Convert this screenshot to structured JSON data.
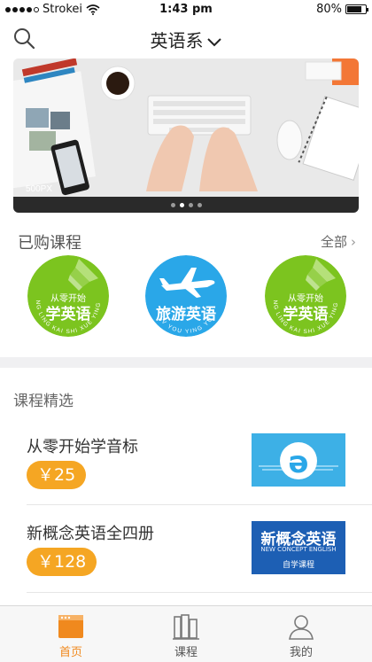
{
  "status_bar": {
    "carrier": "Strokei",
    "time": "1:43 pm",
    "battery": "80%",
    "battery_level": 0.8,
    "signal_bars_filled": 4
  },
  "nav": {
    "title": "英语系"
  },
  "banner": {
    "watermark": "500PX",
    "slide_count": 4,
    "active_slide": 1
  },
  "purchased": {
    "title": "已购课程",
    "view_all": "全部",
    "courses": [
      {
        "sub": "从零开始",
        "main": "学英语",
        "curve": "CONG LING KAI SHI XUE YING YU",
        "color": "#7cc41f"
      },
      {
        "sub": "",
        "main": "旅游英语",
        "curve": "LV YOU YING YU",
        "color": "#2aa7e8"
      },
      {
        "sub": "从零开始",
        "main": "学英语",
        "curve": "CONG LING KAI SHI XUE YING YU",
        "color": "#7cc41f"
      }
    ]
  },
  "picks": {
    "title": "课程精选",
    "items": [
      {
        "name": "从零开始学音标",
        "price": "￥25",
        "thumb_glyph": "ə"
      },
      {
        "name": "新概念英语全四册",
        "price": "￥128",
        "thumb_title": "新概念英语",
        "thumb_en": "NEW CONCEPT ENGLISH",
        "thumb_sub": "自学课程"
      }
    ]
  },
  "tabs": [
    {
      "label": "首页",
      "icon": "home-icon",
      "active": true
    },
    {
      "label": "课程",
      "icon": "books-icon",
      "active": false
    },
    {
      "label": "我的",
      "icon": "user-icon",
      "active": false
    }
  ],
  "colors": {
    "accent": "#f5a623",
    "active_tab": "#f0891e",
    "green_badge": "#7cc41f",
    "blue_badge": "#2aa7e8"
  }
}
